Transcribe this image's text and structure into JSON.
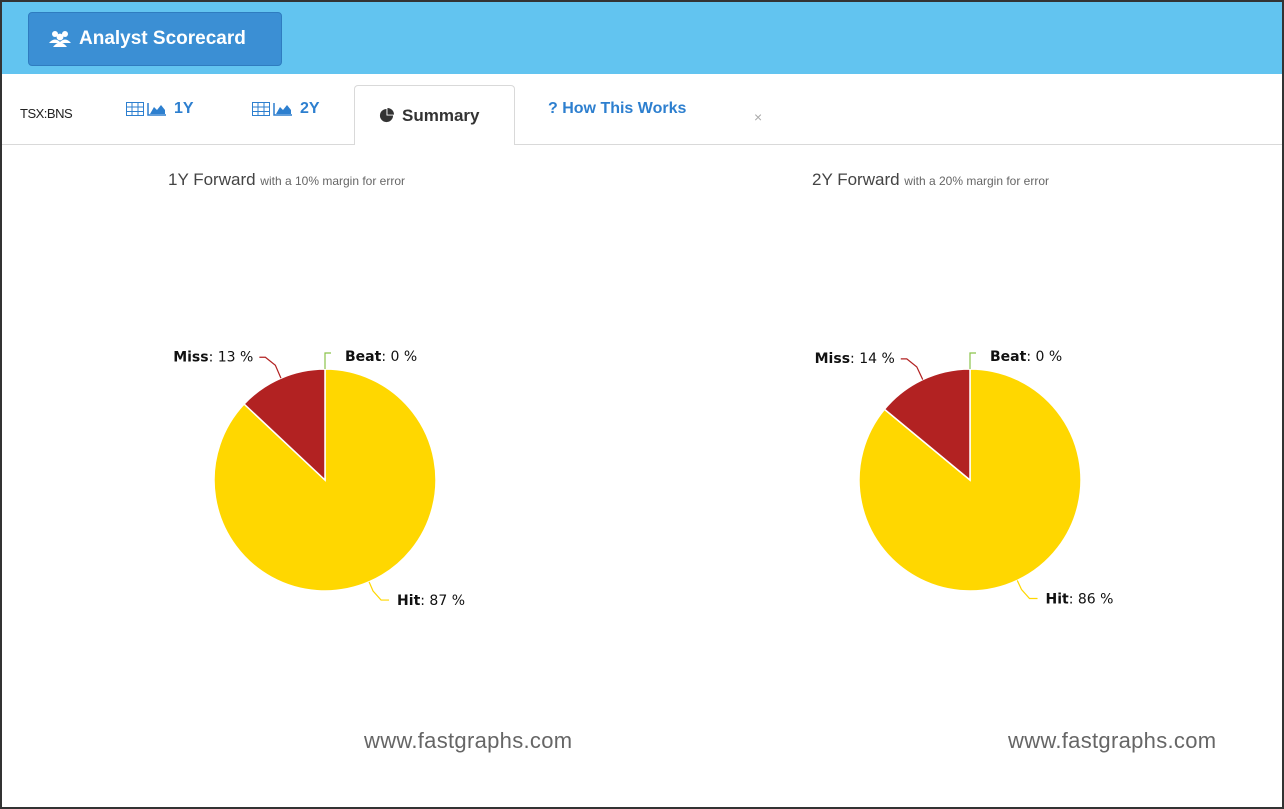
{
  "header": {
    "button_label": "Analyst Scorecard",
    "icon": "users-icon"
  },
  "tabs": {
    "ticker": "TSX:BNS",
    "tab_1y": "1Y",
    "tab_2y": "2Y",
    "summary": "Summary",
    "how": "? How This Works",
    "close": "×"
  },
  "colors": {
    "hit": "#ffd700",
    "miss": "#b22222",
    "beat": "#8bc34a",
    "topbar": "#62c4f0",
    "accent": "#2d7fcf"
  },
  "charts": [
    {
      "title_main": "1Y Forward",
      "title_sub": "with a 10% margin for error",
      "watermark": "www.fastgraphs.com"
    },
    {
      "title_main": "2Y Forward",
      "title_sub": "with a 20% margin for error",
      "watermark": "www.fastgraphs.com"
    }
  ],
  "chart_data": [
    {
      "type": "pie",
      "title": "1Y Forward with a 10% margin for error",
      "slices": [
        {
          "name": "Hit",
          "value": 87,
          "label_suffix": " %"
        },
        {
          "name": "Miss",
          "value": 13,
          "label_suffix": " %"
        },
        {
          "name": "Beat",
          "value": 0,
          "label_suffix": " %"
        }
      ]
    },
    {
      "type": "pie",
      "title": "2Y Forward with a 20% margin for error",
      "slices": [
        {
          "name": "Hit",
          "value": 86,
          "label_suffix": " %"
        },
        {
          "name": "Miss",
          "value": 14,
          "label_suffix": " %"
        },
        {
          "name": "Beat",
          "value": 0,
          "label_suffix": " %"
        }
      ]
    }
  ]
}
